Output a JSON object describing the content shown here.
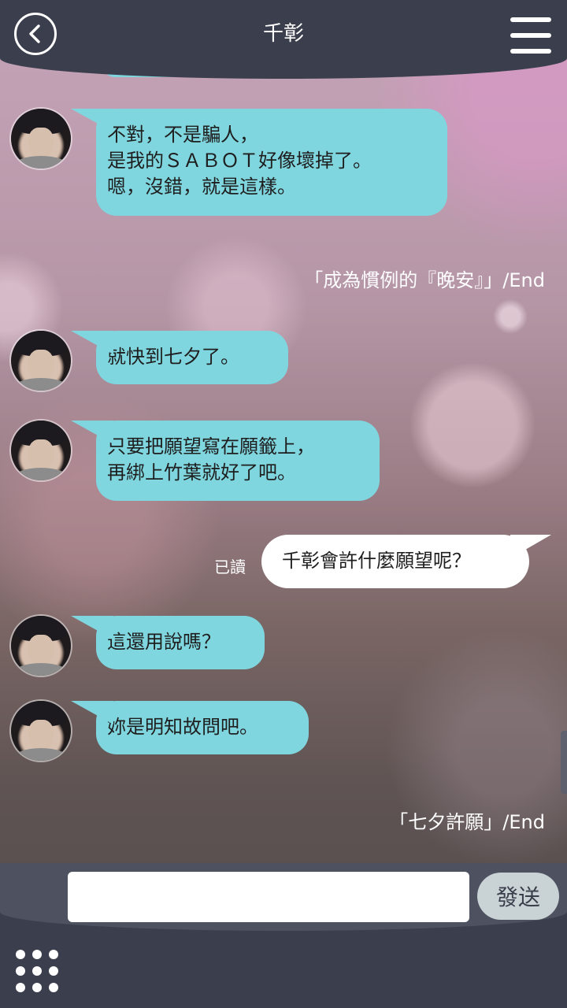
{
  "header": {
    "title": "千彰",
    "back_icon": "chevron-left-icon",
    "menu_icon": "hamburger-menu-icon"
  },
  "messages": [
    {
      "type": "incoming",
      "lines": [
        "不對，不是騙人，",
        "是我的ＳＡＢＯＴ好像壞掉了。",
        "嗯，沒錯，就是這樣。"
      ]
    },
    {
      "type": "episode_end",
      "text": "「成為慣例的『晚安』」/End"
    },
    {
      "type": "incoming",
      "lines": [
        "就快到七夕了。"
      ]
    },
    {
      "type": "incoming",
      "lines": [
        "只要把願望寫在願籤上，",
        "再綁上竹葉就好了吧。"
      ]
    },
    {
      "type": "outgoing",
      "text": "千彰會許什麼願望呢？",
      "status": "已讀"
    },
    {
      "type": "incoming",
      "lines": [
        "這還用說嗎？"
      ]
    },
    {
      "type": "incoming",
      "lines": [
        "妳是明知故問吧。"
      ]
    },
    {
      "type": "episode_end",
      "text": "「七夕許願」/End"
    }
  ],
  "composer": {
    "value": "",
    "send_label": "發送",
    "apps_icon": "grid-dots-icon"
  },
  "colors": {
    "header": "#3b3f4d",
    "incoming_bubble": "#80d6df",
    "outgoing_bubble": "#ffffff",
    "send_button": "#c9d2d4"
  }
}
